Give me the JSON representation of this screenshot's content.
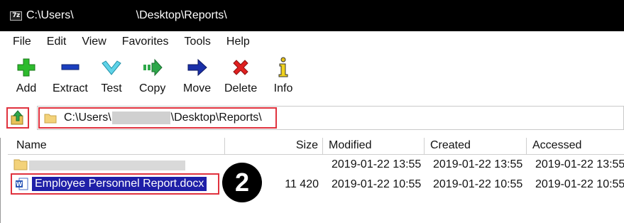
{
  "window": {
    "title_prefix": "C:\\Users\\",
    "title_suffix": "\\Desktop\\Reports\\",
    "app_icon_text": "7z"
  },
  "menu": [
    "File",
    "Edit",
    "View",
    "Favorites",
    "Tools",
    "Help"
  ],
  "toolbar": [
    {
      "label": "Add",
      "icon": "plus-icon"
    },
    {
      "label": "Extract",
      "icon": "minus-icon"
    },
    {
      "label": "Test",
      "icon": "checkmark-icon"
    },
    {
      "label": "Copy",
      "icon": "copy-arrow-icon"
    },
    {
      "label": "Move",
      "icon": "move-arrow-icon"
    },
    {
      "label": "Delete",
      "icon": "delete-x-icon"
    },
    {
      "label": "Info",
      "icon": "info-icon"
    }
  ],
  "address": {
    "prefix": "C:\\Users\\",
    "suffix": "\\Desktop\\Reports\\"
  },
  "columns": [
    "Name",
    "Size",
    "Modified",
    "Created",
    "Accessed"
  ],
  "rows": [
    {
      "name": "",
      "size": "",
      "modified": "2019-01-22 13:55",
      "created": "2019-01-22 13:55",
      "accessed": "2019-01-22 13:55"
    },
    {
      "name": "Employee Personnel Report.docx",
      "size": "11 420",
      "modified": "2019-01-22 10:55",
      "created": "2019-01-22 10:55",
      "accessed": "2019-01-22 10:55"
    }
  ],
  "callout": "2",
  "colors": {
    "highlight": "#e0323e",
    "selection": "#1f1fa8"
  }
}
